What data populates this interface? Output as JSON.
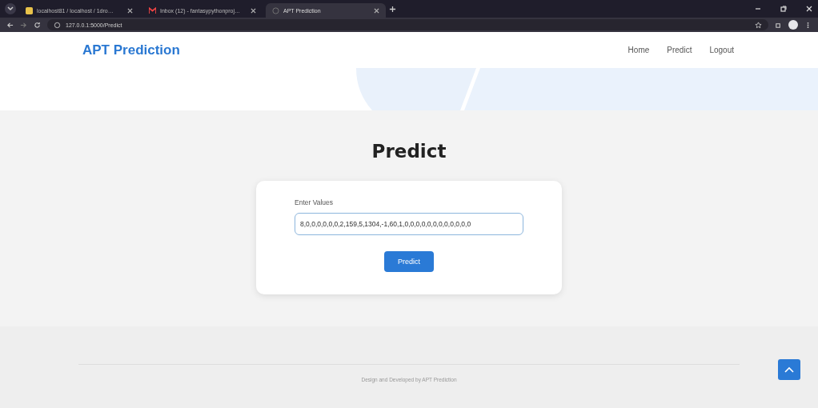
{
  "browser": {
    "tabs": [
      {
        "title": "localhost81 / localhost / 1dro…",
        "kind": "db",
        "selected": false
      },
      {
        "title": "Inbox (12) - fantasypythonproj…",
        "kind": "mail",
        "selected": false
      },
      {
        "title": "APT Prediction",
        "kind": "globe",
        "selected": true
      }
    ],
    "url": "127.0.0.1:5000/Predict"
  },
  "navbar": {
    "brand": "APT Prediction",
    "links": [
      {
        "label": "Home"
      },
      {
        "label": "Predict"
      },
      {
        "label": "Logout"
      }
    ]
  },
  "main": {
    "heading": "Predict",
    "form": {
      "label": "Enter Values",
      "value": "8,0,0,0,0,0,0,2,159,5,1304,-1,60,1,0,0,0,0,0,0,0,0,0,0,0,0",
      "button": "Predict"
    }
  },
  "footer": {
    "text": "Design and Developed by APT Prediction"
  }
}
